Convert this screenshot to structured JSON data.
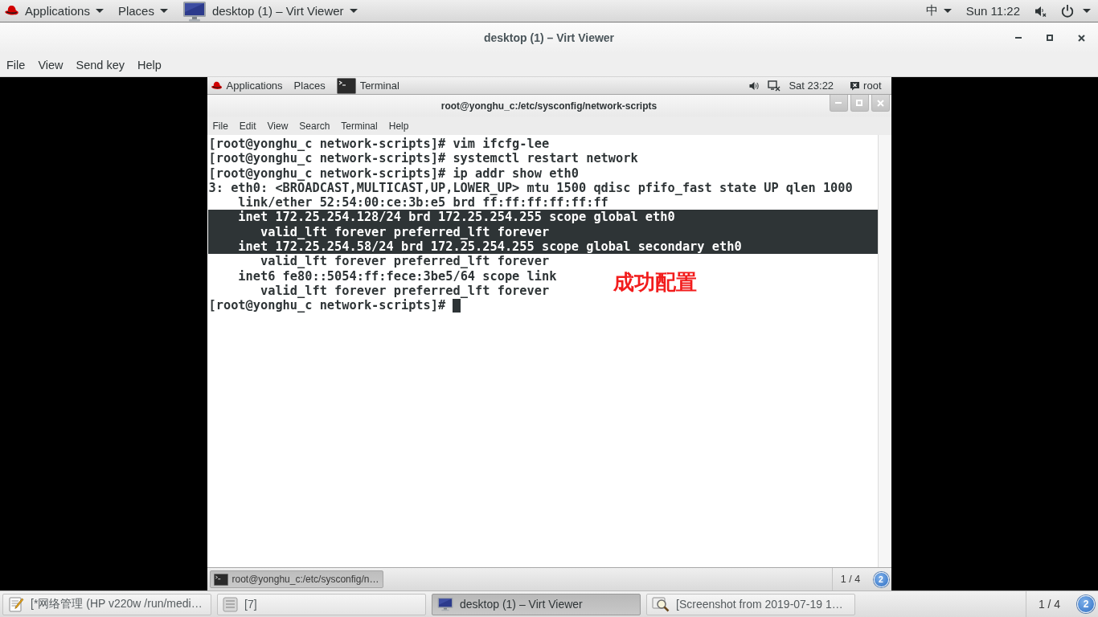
{
  "top_panel": {
    "menus": [
      {
        "label": "Applications",
        "kind": "logo"
      },
      {
        "label": "Places",
        "kind": "plain"
      },
      {
        "label": "desktop (1) – Virt Viewer",
        "kind": "monitor"
      }
    ],
    "input_method": "中",
    "clock": "Sun 11:22"
  },
  "window": {
    "title": "desktop (1) – Virt Viewer",
    "menu": [
      "File",
      "View",
      "Send key",
      "Help"
    ]
  },
  "guest": {
    "top_bar": {
      "menus": [
        {
          "label": "Applications",
          "kind": "logo"
        },
        {
          "label": "Places",
          "kind": "plain"
        },
        {
          "label": "Terminal",
          "kind": "terminal"
        }
      ],
      "clock": "Sat 23:22",
      "user": "root"
    },
    "terminal": {
      "title": "root@yonghu_c:/etc/sysconfig/network-scripts",
      "menu": [
        "File",
        "Edit",
        "View",
        "Search",
        "Terminal",
        "Help"
      ],
      "lines": [
        {
          "text": "[root@yonghu_c network-scripts]# vim ifcfg-lee",
          "selected": false,
          "cursor": false
        },
        {
          "text": "[root@yonghu_c network-scripts]# systemctl restart network",
          "selected": false,
          "cursor": false
        },
        {
          "text": "[root@yonghu_c network-scripts]# ip addr show eth0",
          "selected": false,
          "cursor": false
        },
        {
          "text": "3: eth0: <BROADCAST,MULTICAST,UP,LOWER_UP> mtu 1500 qdisc pfifo_fast state UP qlen 1000",
          "selected": false,
          "cursor": false
        },
        {
          "text": "    link/ether 52:54:00:ce:3b:e5 brd ff:ff:ff:ff:ff:ff",
          "selected": false,
          "cursor": false
        },
        {
          "text": "    inet 172.25.254.128/24 brd 172.25.254.255 scope global eth0",
          "selected": true,
          "cursor": false
        },
        {
          "text": "       valid_lft forever preferred_lft forever",
          "selected": true,
          "cursor": false
        },
        {
          "text": "    inet 172.25.254.58/24 brd 172.25.254.255 scope global secondary eth0",
          "selected": true,
          "cursor": false
        },
        {
          "text": "       valid_lft forever preferred_lft forever",
          "selected": false,
          "cursor": false
        },
        {
          "text": "    inet6 fe80::5054:ff:fece:3be5/64 scope link",
          "selected": false,
          "cursor": false
        },
        {
          "text": "       valid_lft forever preferred_lft forever",
          "selected": false,
          "cursor": false
        },
        {
          "text": "[root@yonghu_c network-scripts]#",
          "selected": false,
          "cursor": true
        }
      ],
      "annotation": "成功配置"
    },
    "taskbar": {
      "tasks": [
        {
          "label": "root@yonghu_c:/etc/sysconfig/n…",
          "kind": "terminal",
          "selected": true
        }
      ],
      "pager": "1 / 4",
      "badge": "2"
    }
  },
  "taskbar": {
    "tasks": [
      {
        "label": "[*网络管理 (HP v220w /run/medi…",
        "kind": "editor",
        "selected": false
      },
      {
        "label": "[7]",
        "kind": "window",
        "selected": false
      },
      {
        "label": "desktop (1) – Virt Viewer",
        "kind": "monitor",
        "selected": true
      },
      {
        "label": "[Screenshot from 2019-07-19 1…",
        "kind": "viewer",
        "selected": false
      }
    ],
    "pager": "1 / 4",
    "badge": "2"
  }
}
